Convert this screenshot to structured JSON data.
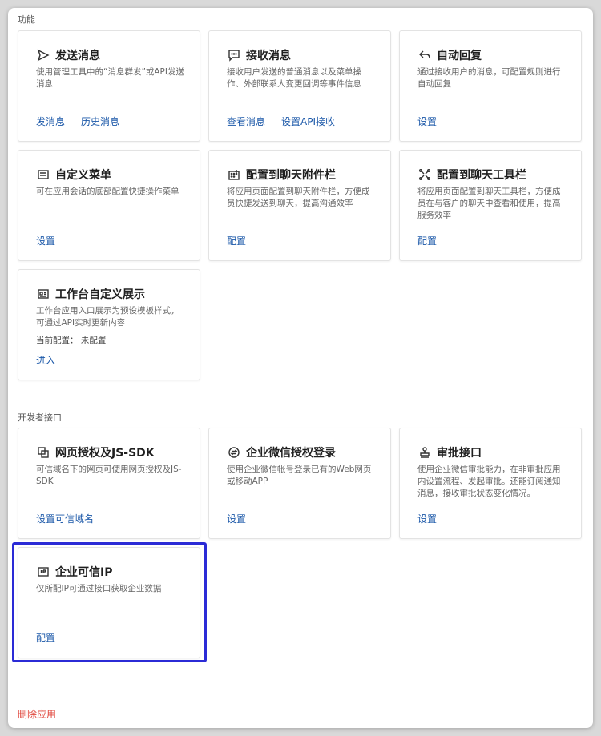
{
  "sections": {
    "features": "功能",
    "developer": "开发者接口"
  },
  "cards": {
    "send": {
      "title": "发送消息",
      "desc": "使用管理工具中的“消息群发”或API发送消息",
      "links": [
        "发消息",
        "历史消息"
      ],
      "icon": "send-icon"
    },
    "receive": {
      "title": "接收消息",
      "desc": "接收用户发送的普通消息以及菜单操作、外部联系人变更回调等事件信息",
      "links": [
        "查看消息",
        "设置API接收"
      ],
      "icon": "chat-icon"
    },
    "autoreply": {
      "title": "自动回复",
      "desc": "通过接收用户的消息，可配置规则进行自动回复",
      "links": [
        "设置"
      ],
      "icon": "reply-icon"
    },
    "menu": {
      "title": "自定义菜单",
      "desc": "可在应用会话的底部配置快捷操作菜单",
      "links": [
        "设置"
      ],
      "icon": "menu-icon"
    },
    "attach": {
      "title": "配置到聊天附件栏",
      "desc": "将应用页面配置到聊天附件栏，方便成员快捷发送到聊天，提高沟通效率",
      "links": [
        "配置"
      ],
      "icon": "attachment-grid-icon"
    },
    "toolbar": {
      "title": "配置到聊天工具栏",
      "desc": "将应用页面配置到聊天工具栏，方便成员在与客户的聊天中查看和使用，提高服务效率",
      "links": [
        "配置"
      ],
      "icon": "toolbar-icon"
    },
    "workbench": {
      "title": "工作台自定义展示",
      "desc": "工作台应用入口展示为预设模板样式，可通过API实时更新内容",
      "status": "当前配置：  未配置",
      "links": [
        "进入"
      ],
      "icon": "workbench-icon"
    },
    "jssdk": {
      "title": "网页授权及JS-SDK",
      "desc": "可信域名下的网页可使用网页授权及JS-SDK",
      "links": [
        "设置可信域名"
      ],
      "icon": "web-auth-icon"
    },
    "oauth": {
      "title": "企业微信授权登录",
      "desc": "使用企业微信帐号登录已有的Web网页或移动APP",
      "links": [
        "设置"
      ],
      "icon": "login-icon"
    },
    "approval": {
      "title": "审批接口",
      "desc": "使用企业微信审批能力，在非审批应用内设置流程、发起审批。还能订阅通知消息，接收审批状态变化情况。",
      "links": [
        "设置"
      ],
      "icon": "stamp-icon"
    },
    "trustedip": {
      "title": "企业可信IP",
      "desc": "仅所配IP可通过接口获取企业数据",
      "links": [
        "配置"
      ],
      "icon": "ip-icon"
    }
  },
  "footer": {
    "delete_label": "删除应用"
  },
  "colors": {
    "link": "#1a57a8",
    "danger": "#e0443a",
    "highlight": "#2b2bd6"
  }
}
